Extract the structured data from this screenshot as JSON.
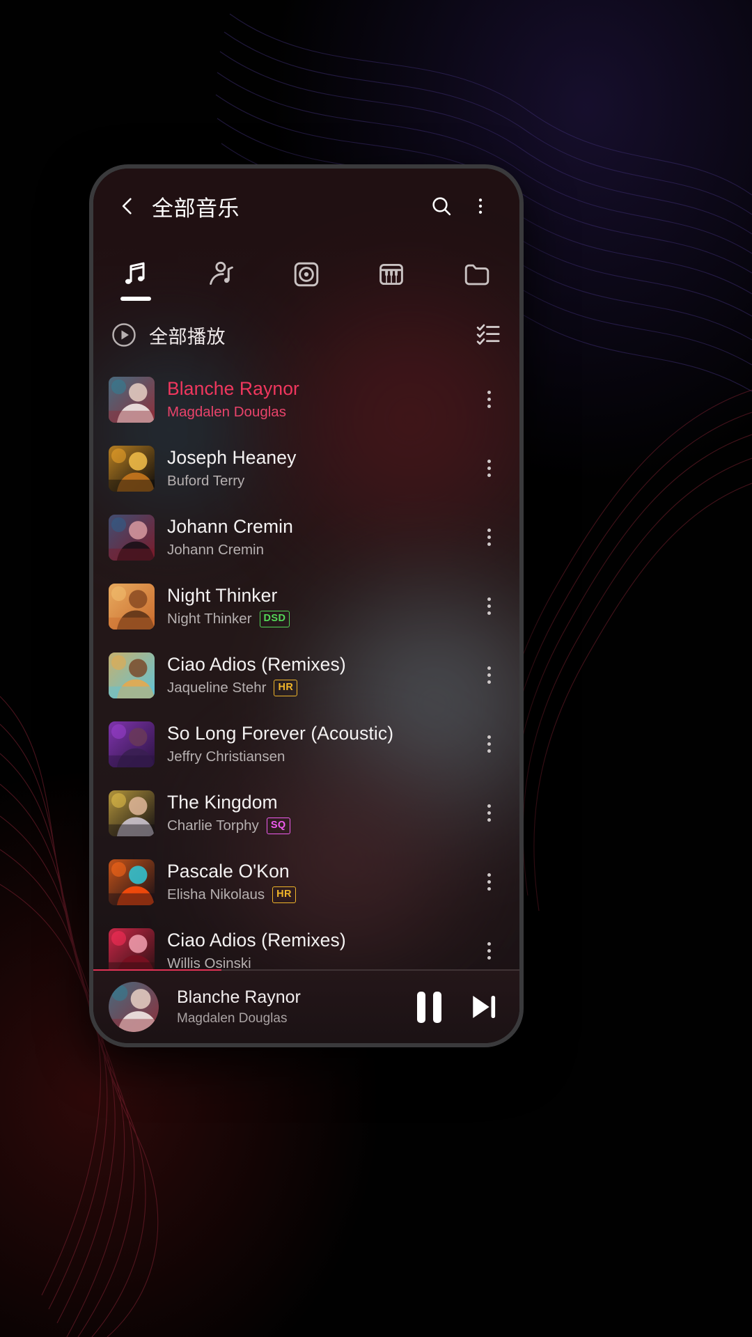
{
  "app": {
    "header": {
      "back_icon": "chevron-left-icon",
      "title": "全部音乐",
      "search_icon": "search-icon",
      "overflow_icon": "overflow-menu-icon"
    },
    "tabs": [
      {
        "id": "songs",
        "icon": "music-note-icon",
        "active": true
      },
      {
        "id": "artists",
        "icon": "artist-icon",
        "active": false
      },
      {
        "id": "albums",
        "icon": "album-disc-icon",
        "active": false
      },
      {
        "id": "genres",
        "icon": "piano-keys-icon",
        "active": false
      },
      {
        "id": "folders",
        "icon": "folder-icon",
        "active": false
      }
    ],
    "playall": {
      "play_icon": "play-circle-icon",
      "label": "全部播放",
      "multiselect_icon": "checklist-icon"
    },
    "songs": [
      {
        "title": "Blanche Raynor",
        "artist": "Magdalen Douglas",
        "badge": "",
        "badge_class": "",
        "playing": true,
        "art": {
          "bg": "#8d2f3a",
          "accent": "#2f7f96",
          "skin": "#e8d0c4",
          "shirt": "#f3e9e6"
        }
      },
      {
        "title": "Joseph Heaney",
        "artist": "Buford Terry",
        "badge": "",
        "badge_class": "",
        "playing": false,
        "art": {
          "bg": "#0b0a0b",
          "accent": "#f0a62a",
          "skin": "#f5c04a",
          "shirt": "#c8771d"
        }
      },
      {
        "title": "Johann Cremin",
        "artist": "Johann Cremin",
        "badge": "",
        "badge_class": "",
        "playing": false,
        "art": {
          "bg": "#7a1b2a",
          "accent": "#2e5f8a",
          "skin": "#d89aa0",
          "shirt": "#1a1016"
        }
      },
      {
        "title": "Night Thinker",
        "artist": "Night Thinker",
        "badge": "DSD",
        "badge_class": "dsd",
        "playing": false,
        "art": {
          "bg": "#c96a2c",
          "accent": "#f2c070",
          "skin": "#8a4a22",
          "shirt": "#5d3317"
        }
      },
      {
        "title": "Ciao Adios (Remixes)",
        "artist": "Jaqueline Stehr",
        "badge": "HR",
        "badge_class": "hr",
        "playing": false,
        "art": {
          "bg": "#5fc4d8",
          "accent": "#e8a94a",
          "skin": "#7a4a2a",
          "shirt": "#e6a94e"
        }
      },
      {
        "title": "So Long Forever (Acoustic)",
        "artist": "Jeffry Christiansen",
        "badge": "",
        "badge_class": "",
        "playing": false,
        "art": {
          "bg": "#2a1340",
          "accent": "#9b3fd0",
          "skin": "#6a3a58",
          "shirt": "#3a1f52"
        }
      },
      {
        "title": "The Kingdom",
        "artist": "Charlie Torphy",
        "badge": "SQ",
        "badge_class": "sq",
        "playing": false,
        "art": {
          "bg": "#120e12",
          "accent": "#e8c24a",
          "skin": "#e0b79a",
          "shirt": "#ccc4d0"
        }
      },
      {
        "title": "Pascale O'Kon",
        "artist": "Elisha Nikolaus",
        "badge": "HR",
        "badge_class": "hr",
        "playing": false,
        "art": {
          "bg": "#140e16",
          "accent": "#ff6a1a",
          "skin": "#2fc8d8",
          "shirt": "#ff4d0a"
        }
      },
      {
        "title": "Ciao Adios (Remixes)",
        "artist": "Willis Osinski",
        "badge": "",
        "badge_class": "",
        "playing": false,
        "art": {
          "bg": "#2a1012",
          "accent": "#ff2f5a",
          "skin": "#f2a0b0",
          "shirt": "#7a1020"
        }
      }
    ],
    "miniplayer": {
      "title": "Blanche Raynor",
      "artist": "Magdalen Douglas",
      "progress_percent": 30,
      "pause_icon": "pause-icon",
      "next_icon": "skip-next-icon",
      "art": {
        "bg": "#8d2f3a",
        "accent": "#2f7f96",
        "skin": "#e8d0c4",
        "shirt": "#f3e9e6"
      }
    }
  },
  "colors": {
    "accent": "#e03355",
    "playing": "#f0375e",
    "badge_dsd": "#53d858",
    "badge_hr": "#f0b52a",
    "badge_sq": "#f05cf0"
  }
}
